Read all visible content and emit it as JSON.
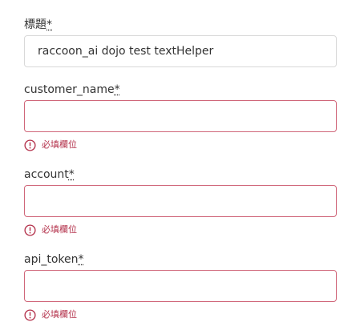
{
  "fields": [
    {
      "label": "標題",
      "required_mark": "*",
      "value": "raccoon_ai dojo test textHelper",
      "placeholder": "",
      "error": ""
    },
    {
      "label": "customer_name",
      "required_mark": "*",
      "value": "",
      "placeholder": "",
      "error": "必填欄位"
    },
    {
      "label": "account",
      "required_mark": "*",
      "value": "",
      "placeholder": "",
      "error": "必填欄位"
    },
    {
      "label": "api_token",
      "required_mark": "*",
      "value": "",
      "placeholder": "",
      "error": "必填欄位"
    }
  ],
  "colors": {
    "error_border": "#d0677a",
    "error_text": "#b3304a",
    "default_border": "#d9d9d9"
  },
  "icons": {
    "error": "exclamation-circle-icon"
  }
}
